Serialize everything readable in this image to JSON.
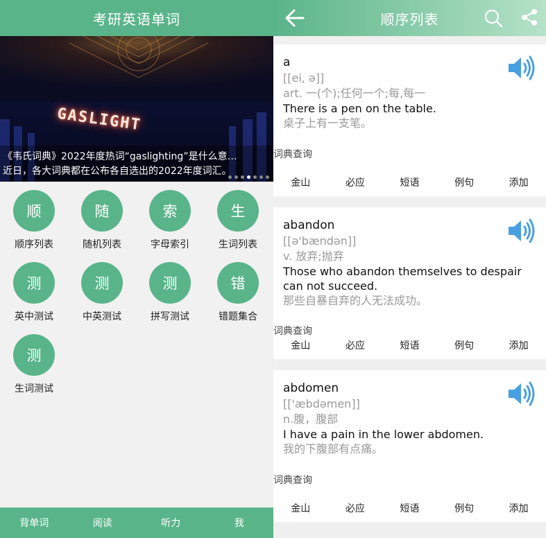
{
  "left": {
    "title": "考研英语单词",
    "banner": {
      "neon_text": "GASLIGHT",
      "caption_line1": "《韦氏词典》2022年度热词“gaslighting”是什么意…",
      "caption_line2": "近日，各大词典都在公布各自选出的2022年度词汇。"
    },
    "grid": [
      {
        "char": "顺",
        "label": "顺序列表"
      },
      {
        "char": "随",
        "label": "随机列表"
      },
      {
        "char": "索",
        "label": "字母索引"
      },
      {
        "char": "生",
        "label": "生词列表"
      },
      {
        "char": "测",
        "label": "英中测试"
      },
      {
        "char": "测",
        "label": "中英测试"
      },
      {
        "char": "测",
        "label": "拼写测试"
      },
      {
        "char": "错",
        "label": "错题集合"
      },
      {
        "char": "测",
        "label": "生词测试"
      }
    ],
    "nav": [
      "背单词",
      "阅读",
      "听力",
      "我"
    ]
  },
  "right": {
    "title": "顺序列表",
    "dict_label": "词典查询",
    "dict_buttons": [
      "金山",
      "必应",
      "短语",
      "例句",
      "添加"
    ],
    "cards": [
      {
        "word": "a",
        "phonetic": "[[ei, ə]]",
        "meaning": "art. 一(个);任何一个;每,每一",
        "sentence": "There is a pen on the table.",
        "translation": "桌子上有一支笔。"
      },
      {
        "word": "abandon",
        "phonetic": "[[ə'bændən]]",
        "meaning": "v. 放弃;抛弃",
        "sentence": "Those who abandon themselves to despair can not succeed.",
        "translation": "那些自暴自弃的人无法成功。"
      },
      {
        "word": "abdomen",
        "phonetic": "[['æbdəmen]]",
        "meaning": "n.腹，腹部",
        "sentence": "I have a pain in the lower abdomen.",
        "translation": "我的下腹部有点痛。"
      }
    ]
  },
  "colors": {
    "accent": "#5ab48a",
    "speaker": "#4a9fe0"
  }
}
